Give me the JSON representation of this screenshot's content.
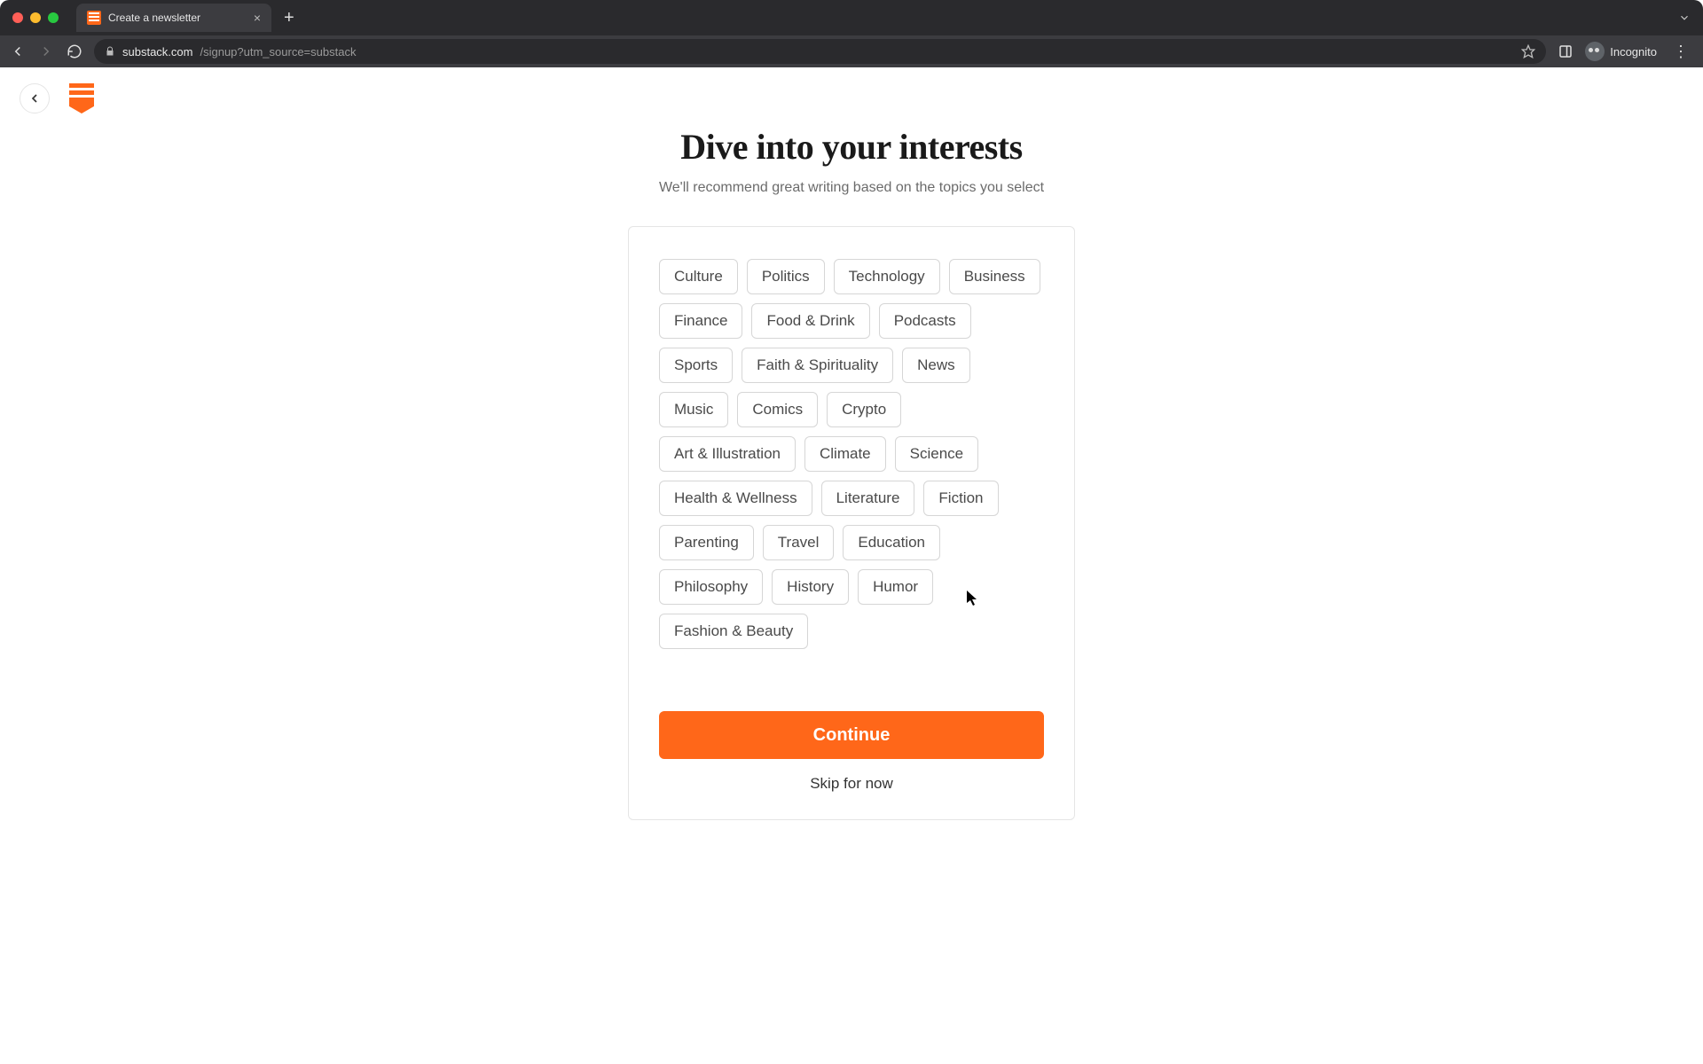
{
  "browser": {
    "tab_title": "Create a newsletter",
    "url_host": "substack.com",
    "url_path": "/signup?utm_source=substack",
    "incognito_label": "Incognito"
  },
  "page": {
    "headline": "Dive into your interests",
    "subhead": "We'll recommend great writing based on the topics you select",
    "continue_label": "Continue",
    "skip_label": "Skip for now"
  },
  "topics": [
    "Culture",
    "Politics",
    "Technology",
    "Business",
    "Finance",
    "Food & Drink",
    "Podcasts",
    "Sports",
    "Faith & Spirituality",
    "News",
    "Music",
    "Comics",
    "Crypto",
    "Art & Illustration",
    "Climate",
    "Science",
    "Health & Wellness",
    "Literature",
    "Fiction",
    "Parenting",
    "Travel",
    "Education",
    "Philosophy",
    "History",
    "Humor",
    "Fashion & Beauty"
  ]
}
